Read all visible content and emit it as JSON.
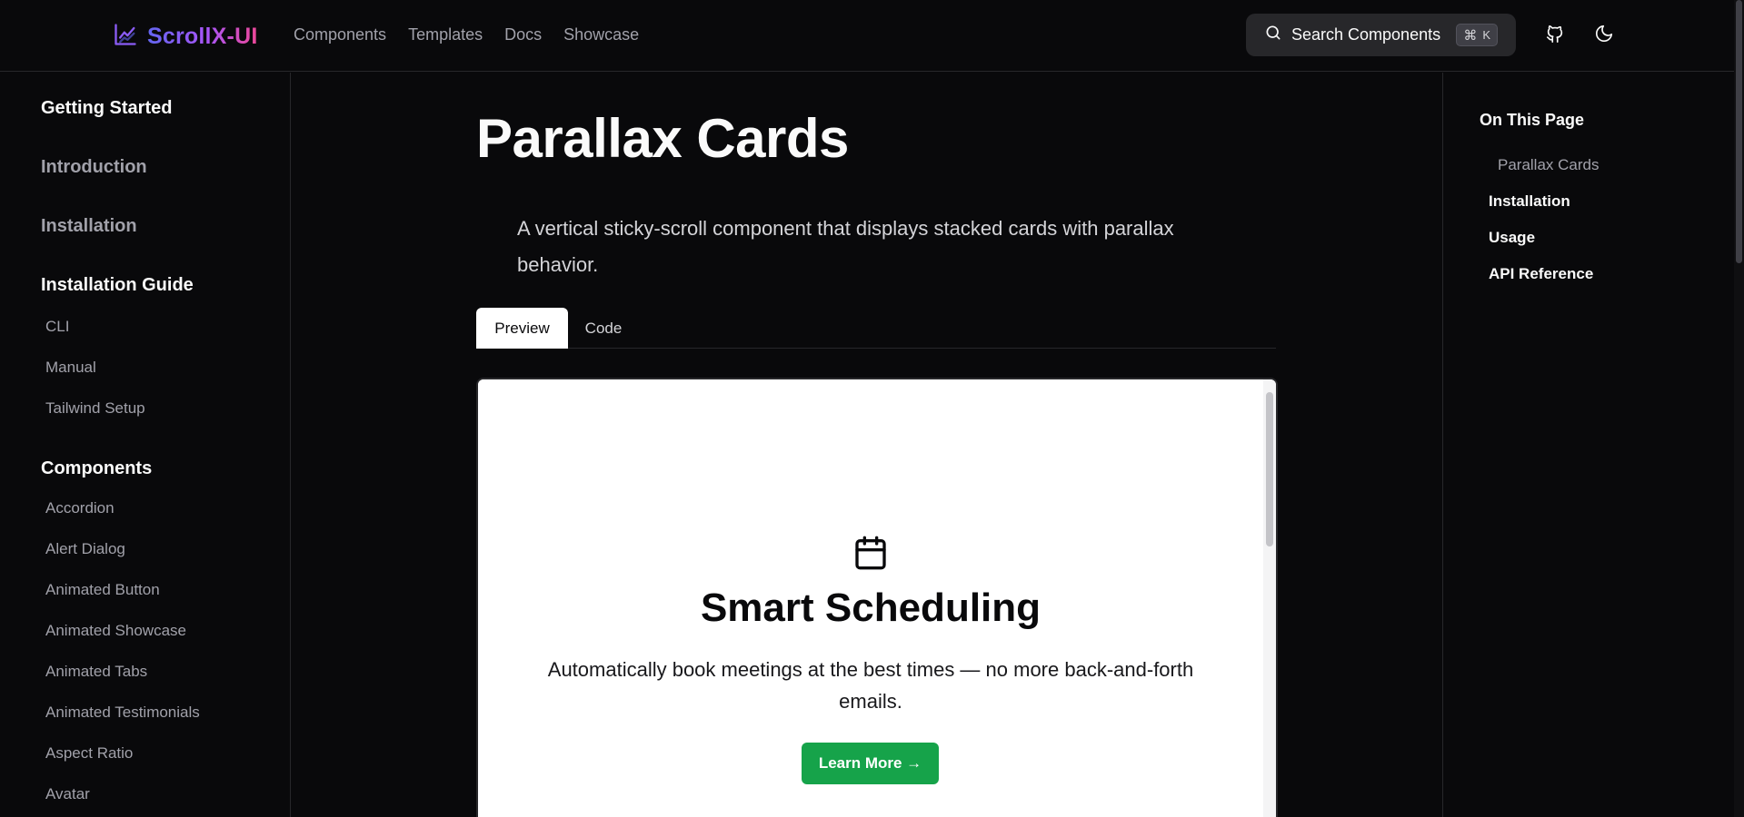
{
  "header": {
    "logo_text": "ScrollX-UI",
    "nav": [
      "Components",
      "Templates",
      "Docs",
      "Showcase"
    ],
    "search_label": "Search Components",
    "search_kbd_cmd": "⌘",
    "search_kbd_key": "K",
    "icons": [
      "github-icon",
      "theme-toggle-icon"
    ]
  },
  "sidebar": {
    "getting_started": "Getting Started",
    "introduction": "Introduction",
    "installation": "Installation",
    "installation_guide": "Installation Guide",
    "guide_items": [
      "CLI",
      "Manual",
      "Tailwind Setup"
    ],
    "components": "Components",
    "component_items": [
      "Accordion",
      "Alert Dialog",
      "Animated Button",
      "Animated Showcase",
      "Animated Tabs",
      "Animated Testimonials",
      "Aspect Ratio",
      "Avatar"
    ]
  },
  "main": {
    "title": "Parallax Cards",
    "description": "A vertical sticky-scroll component that displays stacked cards with parallax behavior.",
    "tabs": [
      "Preview",
      "Code"
    ],
    "card": {
      "icon": "calendar-icon",
      "title": "Smart Scheduling",
      "description": "Automatically book meetings at the best times — no more back-and-forth emails.",
      "button": "Learn More →",
      "button_color": "#16a34a"
    }
  },
  "toc": {
    "heading": "On This Page",
    "sub_item": "Parallax Cards",
    "items": [
      "Installation",
      "Usage",
      "API Reference"
    ]
  },
  "colors": {
    "background": "#09090b",
    "border": "#27272a",
    "muted_text": "#a1a1aa",
    "logo_gradient": [
      "#6366f1",
      "#a855f7",
      "#ec4899"
    ]
  }
}
